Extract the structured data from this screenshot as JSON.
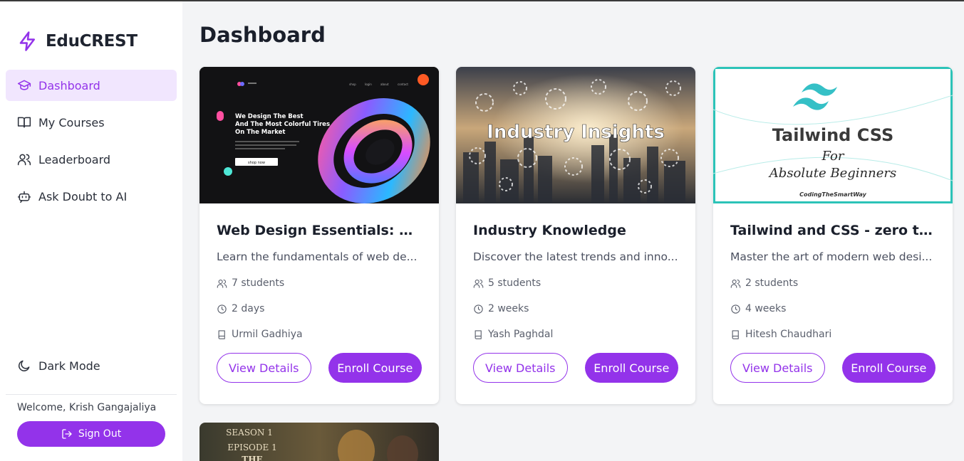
{
  "app": {
    "brand": "EduCREST"
  },
  "sidebar": {
    "items": [
      {
        "label": "Dashboard",
        "icon": "graduation-cap-icon",
        "active": true
      },
      {
        "label": "My Courses",
        "icon": "book-open-icon",
        "active": false
      },
      {
        "label": "Leaderboard",
        "icon": "users-icon",
        "active": false
      },
      {
        "label": "Ask Doubt to AI",
        "icon": "bot-icon",
        "active": false
      }
    ],
    "dark_mode_label": "Dark Mode",
    "welcome": "Welcome, Krish Gangajaliya",
    "sign_out_label": "Sign Out"
  },
  "main": {
    "title": "Dashboard",
    "view_label": "View Details",
    "enroll_label": "Enroll Course",
    "cards": [
      {
        "title": "Web Design Essentials: Cre...",
        "description": "Learn the fundamentals of web de...",
        "students": "7 students",
        "duration": "2 days",
        "instructor": "Urmil Gadhiya",
        "thumb_text": [
          "We Design The Best",
          "And The Most Colorful Tires",
          "On The Market"
        ],
        "thumb_button": "shop now",
        "thumb_nav": [
          "shop",
          "login",
          "about",
          "contact"
        ]
      },
      {
        "title": "Industry Knowledge",
        "description": "Discover the latest trends and inno...",
        "students": "5 students",
        "duration": "2 weeks",
        "instructor": "Yash Paghdal",
        "thumb_text": [
          "Industry Insights"
        ]
      },
      {
        "title": "Tailwind and CSS - zero to ...",
        "description": "Master the art of modern web desi...",
        "students": "2 students",
        "duration": "4 weeks",
        "instructor": "Hitesh Chaudhari",
        "thumb_text": [
          "Tailwind CSS",
          "For",
          "Absolute Beginners",
          "CodingTheSmartWay"
        ]
      }
    ],
    "partial_card": {
      "thumb_text": [
        "SEASON 1",
        "EPISODE 1",
        "THE"
      ]
    }
  },
  "colors": {
    "accent": "#9333ea",
    "active_bg": "#f1e6fe",
    "background": "#f3f4f6"
  }
}
